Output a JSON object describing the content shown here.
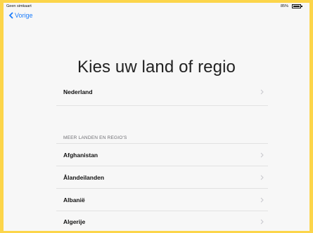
{
  "status_bar": {
    "carrier": "Geen simkaart",
    "battery_percent": "85%",
    "battery_level": 0.85
  },
  "nav": {
    "back_label": "Vorige"
  },
  "page": {
    "title": "Kies uw land of regio"
  },
  "current_region": {
    "label": "Nederland"
  },
  "more_section": {
    "header": "MEER LANDEN EN REGIO'S"
  },
  "countries": [
    {
      "label": "Afghanistan"
    },
    {
      "label": "Ålandeilanden"
    },
    {
      "label": "Albanië"
    },
    {
      "label": "Algerije"
    }
  ],
  "colors": {
    "accent": "#1a7cfb",
    "frame": "#fcd54a",
    "background": "#f7f7f7"
  }
}
